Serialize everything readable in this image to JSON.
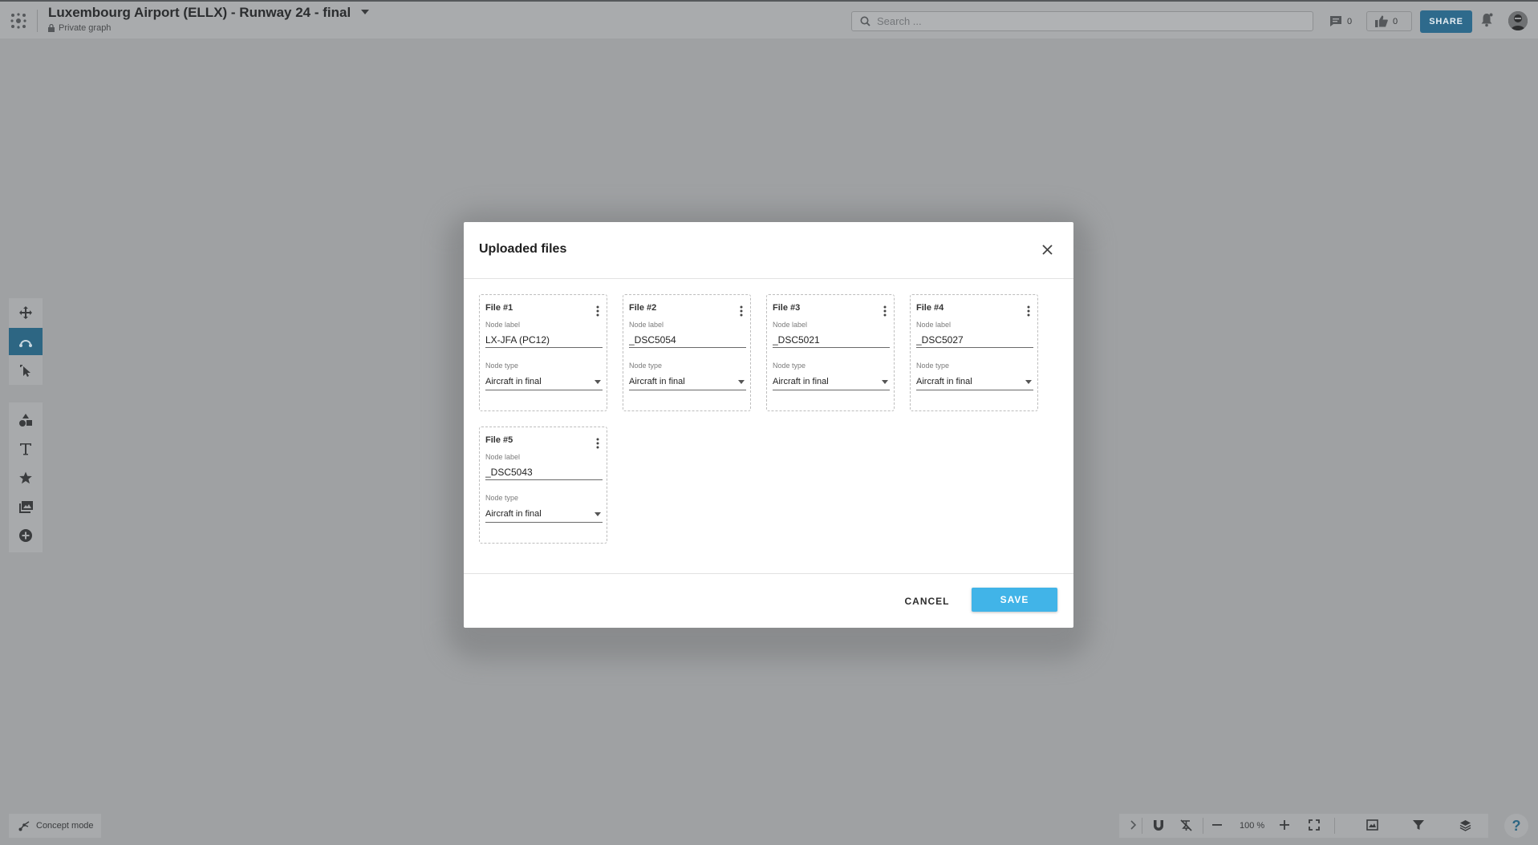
{
  "header": {
    "title": "Luxembourg Airport (ELLX) - Runway 24 - final",
    "privacy": "Private graph",
    "search_placeholder": "Search ...",
    "comments_count": "0",
    "likes_count": "0",
    "share_label": "SHARE"
  },
  "bottom": {
    "concept_mode": "Concept mode",
    "zoom": "100 %",
    "help": "?"
  },
  "modal": {
    "title": "Uploaded files",
    "field_label_caption": "Node label",
    "field_type_caption": "Node type",
    "files": [
      {
        "title": "File #1",
        "label": "LX-JFA (PC12)",
        "type": "Aircraft in final"
      },
      {
        "title": "File #2",
        "label": "_DSC5054",
        "type": "Aircraft in final"
      },
      {
        "title": "File #3",
        "label": "_DSC5021",
        "type": "Aircraft in final"
      },
      {
        "title": "File #4",
        "label": "_DSC5027",
        "type": "Aircraft in final"
      },
      {
        "title": "File #5",
        "label": "_DSC5043",
        "type": "Aircraft in final"
      }
    ],
    "cancel_label": "CANCEL",
    "save_label": "SAVE"
  },
  "colors": {
    "accent": "#41b4e8",
    "share": "#2e6a8c",
    "overlay": "#9fa1a3"
  },
  "icons": {
    "toolbar": [
      "move-icon",
      "connect-icon",
      "select-icon",
      "shapes-icon",
      "text-icon",
      "star-icon",
      "image-icon",
      "add-icon"
    ]
  }
}
